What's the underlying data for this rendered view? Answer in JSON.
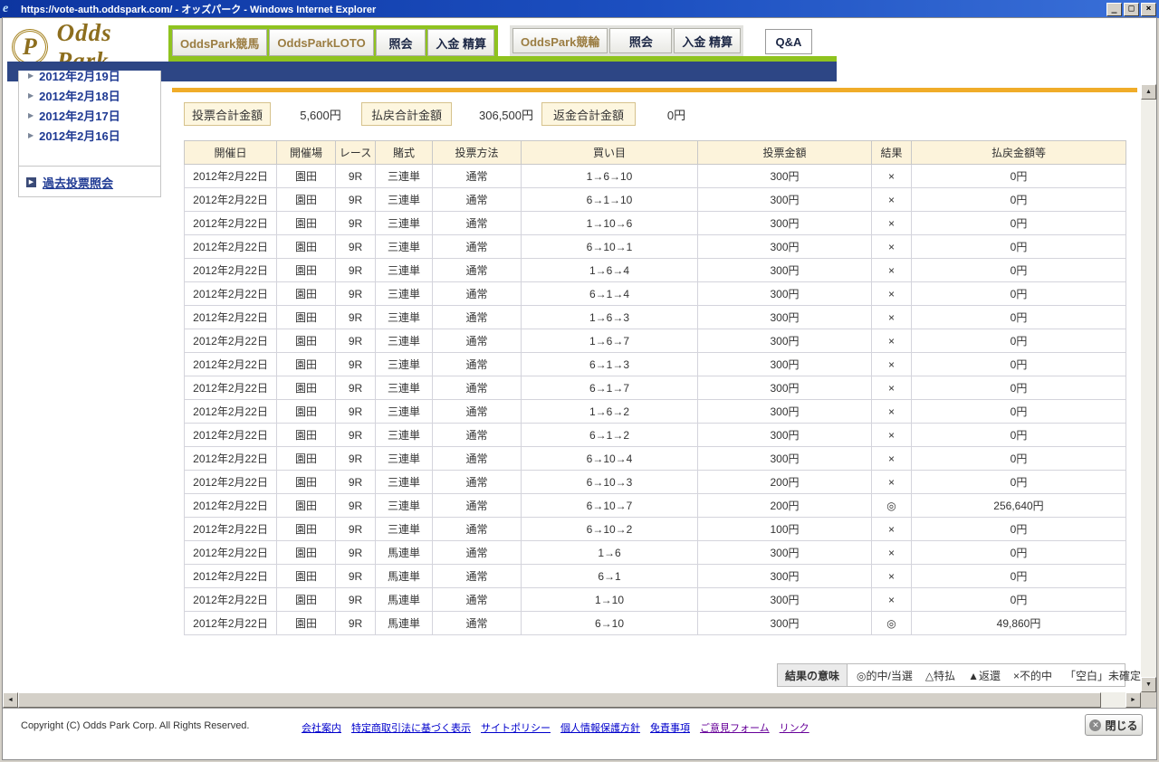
{
  "window": {
    "title": "https://vote-auth.oddspark.com/ - オッズパーク - Windows Internet Explorer",
    "controls": {
      "minimize": "_",
      "maximize": "□",
      "close": "×"
    }
  },
  "colors": {
    "accent_green": "#8FC31F",
    "navy_bar": "#2d4685",
    "gold_bar": "#f0ac29",
    "brand_gold": "#8d6e1e"
  },
  "header": {
    "logo_text": "Odds Park",
    "logo_monogram": "P",
    "nav_keiba": [
      {
        "label": "OddsPark競馬",
        "style": "brand"
      },
      {
        "label": "OddsParkLOTO",
        "style": "brand"
      },
      {
        "label": "照会",
        "style": "action"
      },
      {
        "label": "入金 精算",
        "style": "action"
      }
    ],
    "nav_keirin": [
      {
        "label": "OddsPark競輪",
        "style": "brand"
      },
      {
        "label": "照会",
        "style": "action"
      },
      {
        "label": "入金 精算",
        "style": "action"
      }
    ],
    "qa_label": "Q&A"
  },
  "sidebar": {
    "partial_item": "2012年2月19日",
    "date_items": [
      "2012年2月18日",
      "2012年2月17日",
      "2012年2月16日"
    ],
    "past_votes_link": "過去投票照会"
  },
  "summary": {
    "items": [
      {
        "label": "投票合計金額",
        "value": "5,600円"
      },
      {
        "label": "払戻合計金額",
        "value": "306,500円"
      },
      {
        "label": "返金合計金額",
        "value": "0円"
      }
    ]
  },
  "table": {
    "columns": [
      "開催日",
      "開催場",
      "レース",
      "賭式",
      "投票方法",
      "買い目",
      "投票金額",
      "結果",
      "払戻金額等"
    ],
    "rows": [
      [
        "2012年2月22日",
        "園田",
        "9R",
        "三連単",
        "通常",
        "1→6→10",
        "300円",
        "×",
        "0円"
      ],
      [
        "2012年2月22日",
        "園田",
        "9R",
        "三連単",
        "通常",
        "6→1→10",
        "300円",
        "×",
        "0円"
      ],
      [
        "2012年2月22日",
        "園田",
        "9R",
        "三連単",
        "通常",
        "1→10→6",
        "300円",
        "×",
        "0円"
      ],
      [
        "2012年2月22日",
        "園田",
        "9R",
        "三連単",
        "通常",
        "6→10→1",
        "300円",
        "×",
        "0円"
      ],
      [
        "2012年2月22日",
        "園田",
        "9R",
        "三連単",
        "通常",
        "1→6→4",
        "300円",
        "×",
        "0円"
      ],
      [
        "2012年2月22日",
        "園田",
        "9R",
        "三連単",
        "通常",
        "6→1→4",
        "300円",
        "×",
        "0円"
      ],
      [
        "2012年2月22日",
        "園田",
        "9R",
        "三連単",
        "通常",
        "1→6→3",
        "300円",
        "×",
        "0円"
      ],
      [
        "2012年2月22日",
        "園田",
        "9R",
        "三連単",
        "通常",
        "1→6→7",
        "300円",
        "×",
        "0円"
      ],
      [
        "2012年2月22日",
        "園田",
        "9R",
        "三連単",
        "通常",
        "6→1→3",
        "300円",
        "×",
        "0円"
      ],
      [
        "2012年2月22日",
        "園田",
        "9R",
        "三連単",
        "通常",
        "6→1→7",
        "300円",
        "×",
        "0円"
      ],
      [
        "2012年2月22日",
        "園田",
        "9R",
        "三連単",
        "通常",
        "1→6→2",
        "300円",
        "×",
        "0円"
      ],
      [
        "2012年2月22日",
        "園田",
        "9R",
        "三連単",
        "通常",
        "6→1→2",
        "300円",
        "×",
        "0円"
      ],
      [
        "2012年2月22日",
        "園田",
        "9R",
        "三連単",
        "通常",
        "6→10→4",
        "300円",
        "×",
        "0円"
      ],
      [
        "2012年2月22日",
        "園田",
        "9R",
        "三連単",
        "通常",
        "6→10→3",
        "200円",
        "×",
        "0円"
      ],
      [
        "2012年2月22日",
        "園田",
        "9R",
        "三連単",
        "通常",
        "6→10→7",
        "200円",
        "◎",
        "256,640円"
      ],
      [
        "2012年2月22日",
        "園田",
        "9R",
        "三連単",
        "通常",
        "6→10→2",
        "100円",
        "×",
        "0円"
      ],
      [
        "2012年2月22日",
        "園田",
        "9R",
        "馬連単",
        "通常",
        "1→6",
        "300円",
        "×",
        "0円"
      ],
      [
        "2012年2月22日",
        "園田",
        "9R",
        "馬連単",
        "通常",
        "6→1",
        "300円",
        "×",
        "0円"
      ],
      [
        "2012年2月22日",
        "園田",
        "9R",
        "馬連単",
        "通常",
        "1→10",
        "300円",
        "×",
        "0円"
      ],
      [
        "2012年2月22日",
        "園田",
        "9R",
        "馬連単",
        "通常",
        "6→10",
        "300円",
        "◎",
        "49,860円"
      ]
    ]
  },
  "legend": {
    "title": "結果の意味",
    "items": [
      "◎的中/当選",
      "△特払",
      "▲返還",
      "×不的中",
      "「空白」未確定"
    ]
  },
  "footer": {
    "copyright": "Copyright (C) Odds Park Corp. All Rights Reserved.",
    "links": [
      {
        "label": "会社案内",
        "visited": false
      },
      {
        "label": "特定商取引法に基づく表示",
        "visited": false
      },
      {
        "label": "サイトポリシー",
        "visited": false
      },
      {
        "label": "個人情報保護方針",
        "visited": false
      },
      {
        "label": "免責事項",
        "visited": false
      },
      {
        "label": "ご意見フォーム",
        "visited": true
      },
      {
        "label": "リンク",
        "visited": true
      }
    ],
    "close_label": "閉じる"
  }
}
